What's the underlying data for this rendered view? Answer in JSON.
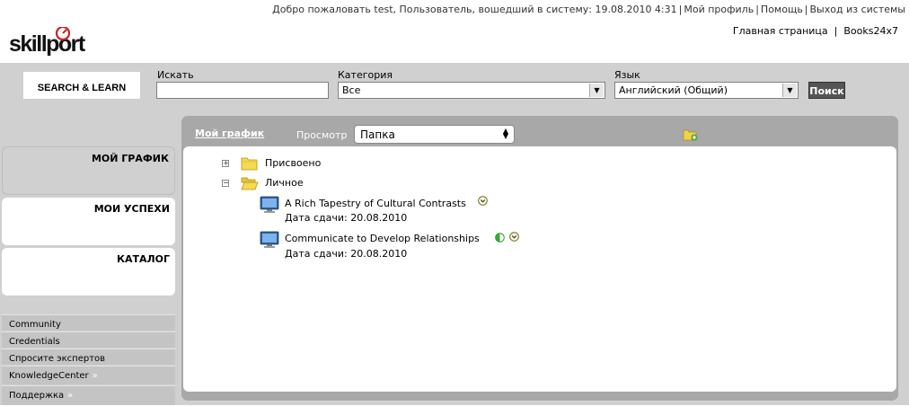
{
  "header": {
    "welcome": "Добро пожаловать test, Пользователь, вошедший в систему: 19.08.2010 4:31",
    "my_profile": "Мой профиль",
    "help": "Помощь",
    "logout": "Выход из системы",
    "logo_text": "skillport",
    "home": "Главная страница",
    "books": "Books24x7"
  },
  "search": {
    "logo_text": "SEARCH & LEARN",
    "search_label": "Искать",
    "search_value": "",
    "category_label": "Категория",
    "category_value": "Все",
    "language_label": "Язык",
    "language_value": "Английский (Общий)",
    "go_label": "Поиск"
  },
  "nav": {
    "tabs": [
      {
        "label": "МОЙ ГРАФИК"
      },
      {
        "label": "МОИ УСПЕХИ"
      },
      {
        "label": "КАТАЛОГ"
      }
    ],
    "links": [
      {
        "label": "Community"
      },
      {
        "label": "Credentials"
      },
      {
        "label": "Спросите экспертов"
      },
      {
        "label": "KnowledgeCenter"
      },
      {
        "label": "Поддержка"
      }
    ]
  },
  "panel": {
    "title": "Мой график",
    "view_label": "Просмотр",
    "view_value": "Папка",
    "tree": [
      {
        "label": "Присвоено",
        "expander": "+"
      },
      {
        "label": "Личное",
        "expander": "−"
      }
    ],
    "items": [
      {
        "title": "A Rich Tapestry of Cultural Contrasts",
        "due": "Дата сдачи: 20.08.2010"
      },
      {
        "title": "Communicate to Develop Relationships",
        "due": "Дата сдачи: 20.08.2010"
      }
    ]
  },
  "colors": {
    "logo_red": "#cc2222",
    "panel_grey": "#a8a8a8",
    "band_grey": "#d0d0d0",
    "status_green": "#33aa33"
  }
}
